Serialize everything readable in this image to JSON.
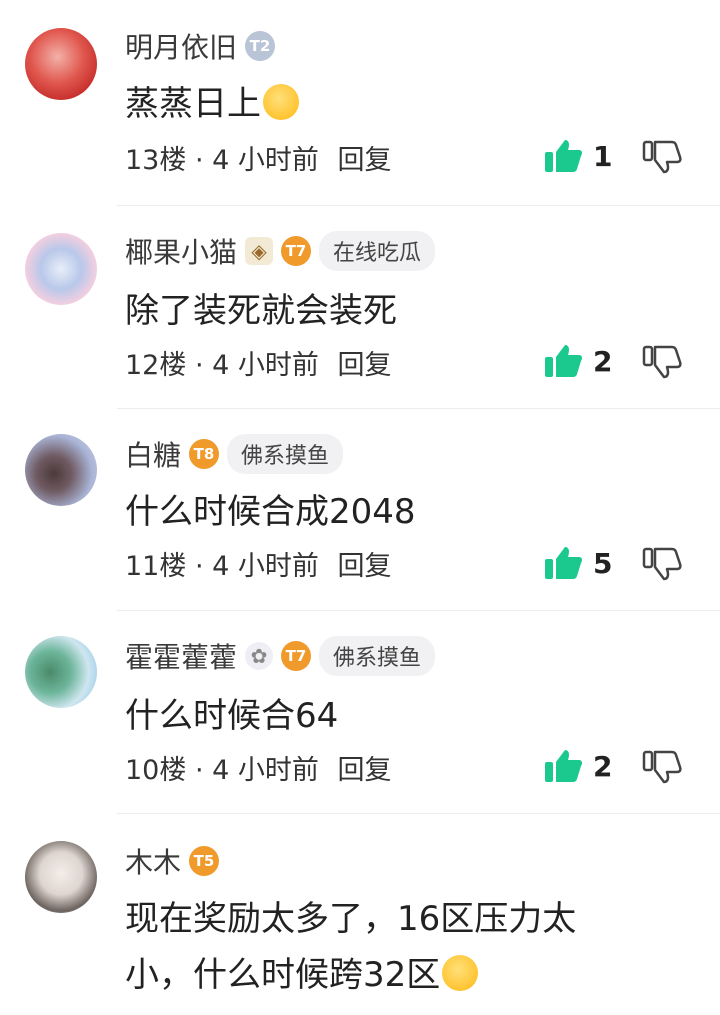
{
  "comments": [
    {
      "username": "明月依旧",
      "level_icon": "T2",
      "content": "蒸蒸日上",
      "content_emoji": "grinning-face-emoji",
      "floor": "13楼",
      "time": "4 小时前",
      "reply": "回复",
      "likes": "1"
    },
    {
      "username": "椰果小猫",
      "decoration_icon": "shield-badge-icon",
      "level_icon": "T7",
      "tag": "在线吃瓜",
      "content": "除了装死就会装死",
      "floor": "12楼",
      "time": "4 小时前",
      "reply": "回复",
      "likes": "2"
    },
    {
      "username": "白糖",
      "level_icon": "T8",
      "tag": "佛系摸鱼",
      "content": "什么时候合成2048",
      "floor": "11楼",
      "time": "4 小时前",
      "reply": "回复",
      "likes": "5"
    },
    {
      "username": "霍霍藿藿",
      "decoration_icon": "anime-girl-badge-icon",
      "level_icon": "T7",
      "tag": "佛系摸鱼",
      "content": "什么时候合64",
      "floor": "10楼",
      "time": "4 小时前",
      "reply": "回复",
      "likes": "2"
    },
    {
      "username": "木木",
      "level_icon": "T5",
      "content_line1": "现在奖励太多了，16区压力太",
      "content_line2": "小，什么时候跨32区",
      "content_emoji": "smiling-face-emoji"
    }
  ],
  "colors": {
    "like_green": "#1bc98e",
    "level_orange": "#f09a2b",
    "level_gray": "#b9c4d6"
  }
}
